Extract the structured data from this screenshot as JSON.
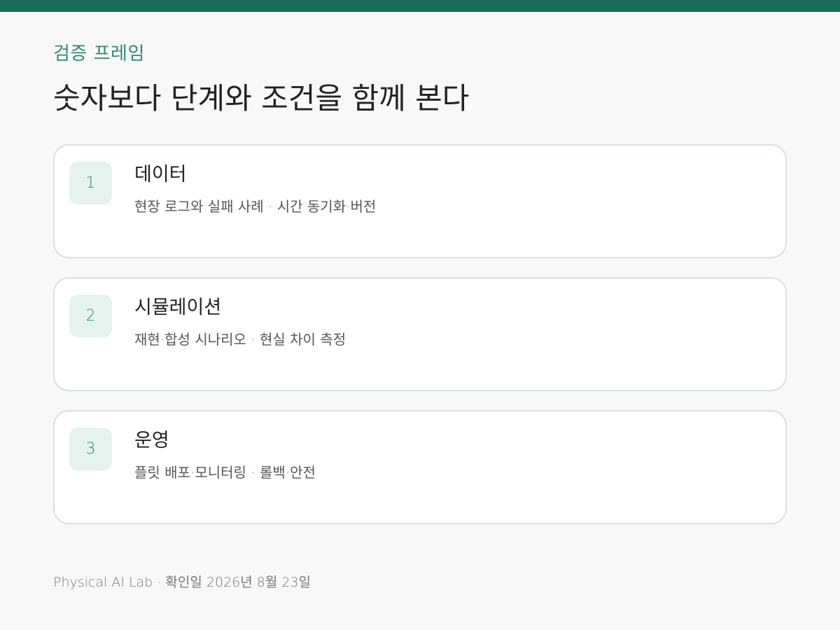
{
  "header": {
    "kicker": "검증 프레임",
    "title": "숫자보다 단계와 조건을 함께 본다"
  },
  "steps": [
    {
      "number": "1",
      "title": "데이터",
      "description": "현장 로그와 실패 사례 · 시간 동기화·버전"
    },
    {
      "number": "2",
      "title": "시뮬레이션",
      "description": "재현·합성 시나리오 · 현실 차이 측정"
    },
    {
      "number": "3",
      "title": "운영",
      "description": "플릿 배포·모니터링 · 롤백·안전"
    }
  ],
  "footer": {
    "text": "Physical AI Lab · 확인일 2026년 8월 23일"
  },
  "colors": {
    "accent": "#1a6b5a",
    "kicker": "#2f8a6f",
    "badge_bg": "#e5f2ee"
  }
}
